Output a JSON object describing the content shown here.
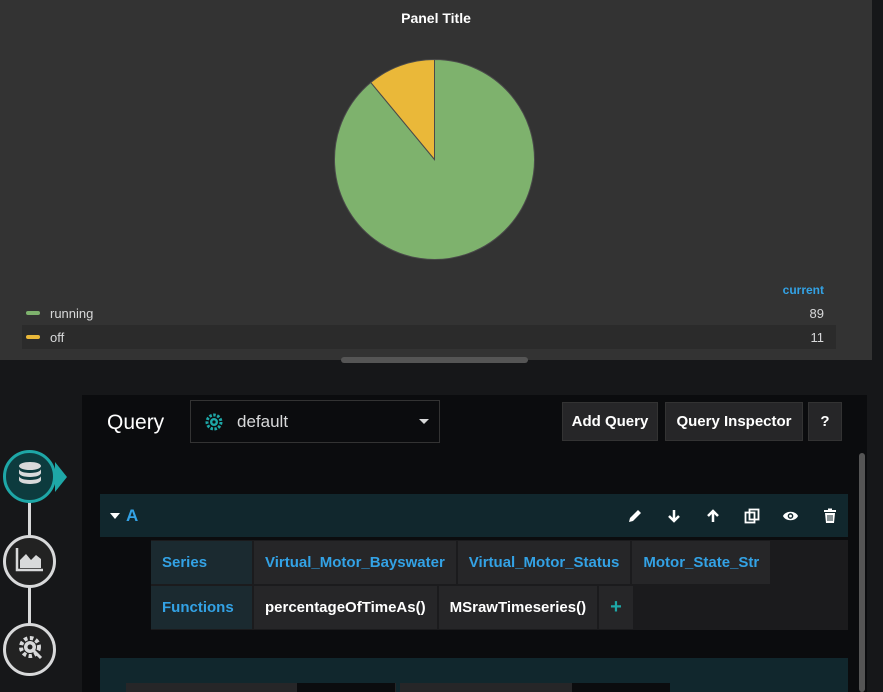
{
  "panel": {
    "title": "Panel Title",
    "legend_header": "current",
    "legend": [
      {
        "label": "running",
        "value": "89",
        "color": "#7eb26d"
      },
      {
        "label": "off",
        "value": "11",
        "color": "#eab839"
      }
    ]
  },
  "chart_data": {
    "type": "pie",
    "title": "Panel Title",
    "categories": [
      "running",
      "off"
    ],
    "values": [
      89,
      11
    ],
    "colors": [
      "#7eb26d",
      "#eab839"
    ],
    "legend_placement": "bottom"
  },
  "editor": {
    "title": "Query",
    "datasource": "default",
    "add_query": "Add Query",
    "query_inspector": "Query Inspector",
    "help": "?",
    "query": {
      "ref_id": "A",
      "series_label": "Series",
      "series": [
        "Virtual_Motor_Bayswater",
        "Virtual_Motor_Status",
        "Motor_State_Str"
      ],
      "functions_label": "Functions",
      "functions": [
        "percentageOfTimeAs()",
        "MSrawTimeseries()"
      ],
      "add_function": "+"
    }
  },
  "icons": {
    "datasource": "gear-icon",
    "rail": [
      "database-icon",
      "chart-icon",
      "settings-icon"
    ],
    "row": [
      "pencil-icon",
      "arrow-down-icon",
      "arrow-up-icon",
      "duplicate-icon",
      "eye-icon",
      "trash-icon"
    ]
  }
}
